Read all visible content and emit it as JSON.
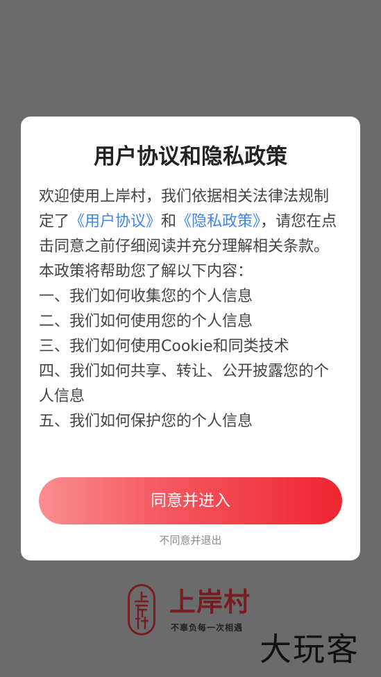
{
  "dialog": {
    "title": "用户协议和隐私政策",
    "intro_before_links": "欢迎使用上岸村，我们依据相关法律法规制定了",
    "user_agreement_link": "《用户协议》",
    "and_text": "和",
    "privacy_policy_link": "《隐私政策》",
    "intro_after_links": "，请您在点击同意之前仔细阅读并充分理解相关条款。",
    "summary_heading": "本政策将帮助您了解以下内容：",
    "sections": [
      "一、我们如何收集您的个人信息",
      "二、我们如何使用您的个人信息",
      "三、我们如何使用Cookie和同类技术",
      "四、我们如何共享、转让、公开披露您的个人信息",
      "五、我们如何保护您的个人信息"
    ],
    "agree_button": "同意并进入",
    "disagree_link": "不同意并退出"
  },
  "brand": {
    "name": "上岸村",
    "slogan": "不辜负每一次相遇",
    "seal_text": "上岸村",
    "color": "#7a1d22"
  },
  "watermark": "大玩客",
  "colors": {
    "overlay": "#6b6b6b",
    "link": "#3f86e8",
    "button_start": "#f98d8f",
    "button_end": "#ee2531"
  }
}
